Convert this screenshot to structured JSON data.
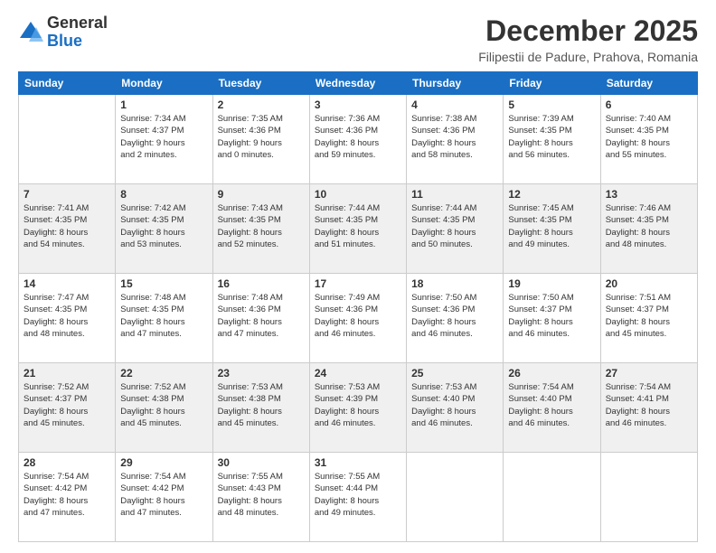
{
  "logo": {
    "general": "General",
    "blue": "Blue"
  },
  "header": {
    "title": "December 2025",
    "subtitle": "Filipestii de Padure, Prahova, Romania"
  },
  "weekdays": [
    "Sunday",
    "Monday",
    "Tuesday",
    "Wednesday",
    "Thursday",
    "Friday",
    "Saturday"
  ],
  "weeks": [
    [
      {
        "day": "",
        "info": ""
      },
      {
        "day": "1",
        "info": "Sunrise: 7:34 AM\nSunset: 4:37 PM\nDaylight: 9 hours\nand 2 minutes."
      },
      {
        "day": "2",
        "info": "Sunrise: 7:35 AM\nSunset: 4:36 PM\nDaylight: 9 hours\nand 0 minutes."
      },
      {
        "day": "3",
        "info": "Sunrise: 7:36 AM\nSunset: 4:36 PM\nDaylight: 8 hours\nand 59 minutes."
      },
      {
        "day": "4",
        "info": "Sunrise: 7:38 AM\nSunset: 4:36 PM\nDaylight: 8 hours\nand 58 minutes."
      },
      {
        "day": "5",
        "info": "Sunrise: 7:39 AM\nSunset: 4:35 PM\nDaylight: 8 hours\nand 56 minutes."
      },
      {
        "day": "6",
        "info": "Sunrise: 7:40 AM\nSunset: 4:35 PM\nDaylight: 8 hours\nand 55 minutes."
      }
    ],
    [
      {
        "day": "7",
        "info": "Sunrise: 7:41 AM\nSunset: 4:35 PM\nDaylight: 8 hours\nand 54 minutes."
      },
      {
        "day": "8",
        "info": "Sunrise: 7:42 AM\nSunset: 4:35 PM\nDaylight: 8 hours\nand 53 minutes."
      },
      {
        "day": "9",
        "info": "Sunrise: 7:43 AM\nSunset: 4:35 PM\nDaylight: 8 hours\nand 52 minutes."
      },
      {
        "day": "10",
        "info": "Sunrise: 7:44 AM\nSunset: 4:35 PM\nDaylight: 8 hours\nand 51 minutes."
      },
      {
        "day": "11",
        "info": "Sunrise: 7:44 AM\nSunset: 4:35 PM\nDaylight: 8 hours\nand 50 minutes."
      },
      {
        "day": "12",
        "info": "Sunrise: 7:45 AM\nSunset: 4:35 PM\nDaylight: 8 hours\nand 49 minutes."
      },
      {
        "day": "13",
        "info": "Sunrise: 7:46 AM\nSunset: 4:35 PM\nDaylight: 8 hours\nand 48 minutes."
      }
    ],
    [
      {
        "day": "14",
        "info": "Sunrise: 7:47 AM\nSunset: 4:35 PM\nDaylight: 8 hours\nand 48 minutes."
      },
      {
        "day": "15",
        "info": "Sunrise: 7:48 AM\nSunset: 4:35 PM\nDaylight: 8 hours\nand 47 minutes."
      },
      {
        "day": "16",
        "info": "Sunrise: 7:48 AM\nSunset: 4:36 PM\nDaylight: 8 hours\nand 47 minutes."
      },
      {
        "day": "17",
        "info": "Sunrise: 7:49 AM\nSunset: 4:36 PM\nDaylight: 8 hours\nand 46 minutes."
      },
      {
        "day": "18",
        "info": "Sunrise: 7:50 AM\nSunset: 4:36 PM\nDaylight: 8 hours\nand 46 minutes."
      },
      {
        "day": "19",
        "info": "Sunrise: 7:50 AM\nSunset: 4:37 PM\nDaylight: 8 hours\nand 46 minutes."
      },
      {
        "day": "20",
        "info": "Sunrise: 7:51 AM\nSunset: 4:37 PM\nDaylight: 8 hours\nand 45 minutes."
      }
    ],
    [
      {
        "day": "21",
        "info": "Sunrise: 7:52 AM\nSunset: 4:37 PM\nDaylight: 8 hours\nand 45 minutes."
      },
      {
        "day": "22",
        "info": "Sunrise: 7:52 AM\nSunset: 4:38 PM\nDaylight: 8 hours\nand 45 minutes."
      },
      {
        "day": "23",
        "info": "Sunrise: 7:53 AM\nSunset: 4:38 PM\nDaylight: 8 hours\nand 45 minutes."
      },
      {
        "day": "24",
        "info": "Sunrise: 7:53 AM\nSunset: 4:39 PM\nDaylight: 8 hours\nand 46 minutes."
      },
      {
        "day": "25",
        "info": "Sunrise: 7:53 AM\nSunset: 4:40 PM\nDaylight: 8 hours\nand 46 minutes."
      },
      {
        "day": "26",
        "info": "Sunrise: 7:54 AM\nSunset: 4:40 PM\nDaylight: 8 hours\nand 46 minutes."
      },
      {
        "day": "27",
        "info": "Sunrise: 7:54 AM\nSunset: 4:41 PM\nDaylight: 8 hours\nand 46 minutes."
      }
    ],
    [
      {
        "day": "28",
        "info": "Sunrise: 7:54 AM\nSunset: 4:42 PM\nDaylight: 8 hours\nand 47 minutes."
      },
      {
        "day": "29",
        "info": "Sunrise: 7:54 AM\nSunset: 4:42 PM\nDaylight: 8 hours\nand 47 minutes."
      },
      {
        "day": "30",
        "info": "Sunrise: 7:55 AM\nSunset: 4:43 PM\nDaylight: 8 hours\nand 48 minutes."
      },
      {
        "day": "31",
        "info": "Sunrise: 7:55 AM\nSunset: 4:44 PM\nDaylight: 8 hours\nand 49 minutes."
      },
      {
        "day": "",
        "info": ""
      },
      {
        "day": "",
        "info": ""
      },
      {
        "day": "",
        "info": ""
      }
    ]
  ]
}
